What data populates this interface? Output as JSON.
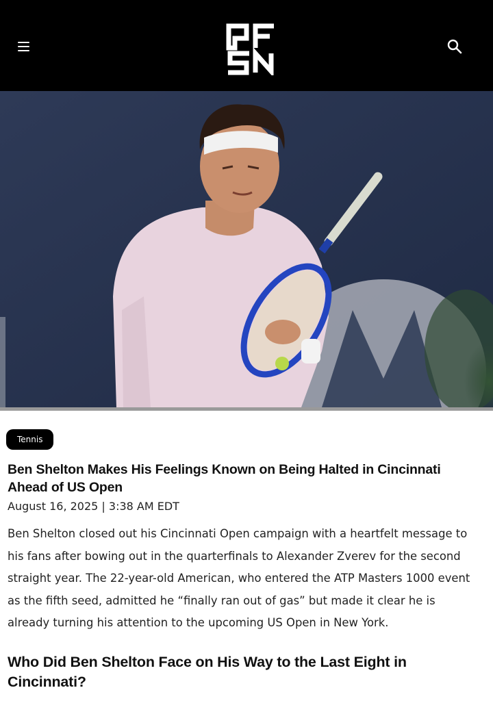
{
  "header": {
    "logo_text": "PFSN",
    "menu_icon": "hamburger-menu-icon",
    "search_icon": "search-icon",
    "background": "#000000"
  },
  "hero": {
    "photo_description_icon": "hero-photo"
  },
  "article": {
    "category": "Tennis",
    "title": "Ben Shelton Makes His Feelings Known on Being Halted in Cincinnati Ahead of US Open",
    "date": "August 16, 2025 | 3:38 AM EDT",
    "body": "Ben Shelton closed out his Cincinnati Open campaign with a heartfelt message to his fans after bowing out in the quarterfinals to Alexander Zverev for the second straight year. The 22-year-old American, who entered the ATP Masters 1000 event as the fifth seed, admitted he “finally ran out of gas” but made it clear he is already turning his attention to the upcoming US Open in New York.",
    "subheading": "Who Did Ben Shelton Face on His Way to the Last Eight in Cincinnati?"
  }
}
